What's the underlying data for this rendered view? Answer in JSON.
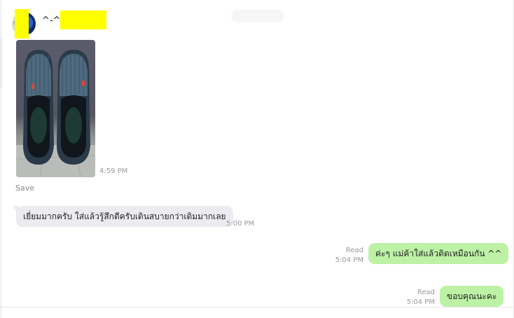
{
  "header": {
    "sender_name": "^-^(          *@*-^"
  },
  "messages": [
    {
      "type": "image",
      "direction": "in",
      "time": "4:59 PM",
      "action": "Save"
    },
    {
      "type": "text",
      "direction": "in",
      "text": "เยี่ยมมากครับ ใส่แล้วรู้สึกดีครับเดินสบายกว่าเดิมมากเลย",
      "time": "5:00 PM"
    },
    {
      "type": "text",
      "direction": "out",
      "text": "ค่ะๆ แม่ค้าใส่แล้วติดเหมือนกัน ^^",
      "status": "Read",
      "time": "5:04 PM"
    },
    {
      "type": "text",
      "direction": "out",
      "text": "ขอบคุณนะคะ",
      "status": "Read",
      "time": "5:04 PM"
    }
  ],
  "colors": {
    "incoming_bubble": "#ececf0",
    "outgoing_bubble": "#bdf2a6",
    "redaction": "#ffff00"
  }
}
